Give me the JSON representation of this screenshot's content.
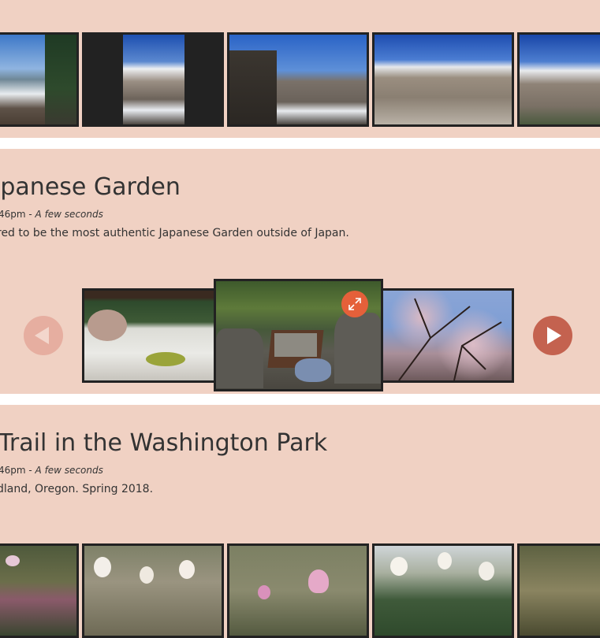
{
  "albums": [
    {
      "title": "apanese Garden",
      "meta_time": "46pm - ",
      "meta_duration": "A few seconds",
      "description": "red to be the most authentic Japanese Garden outside of Japan."
    },
    {
      "title": "Trail in the Washington Park",
      "meta_time": "46pm - ",
      "meta_duration": "A few seconds",
      "description": "dland, Oregon. Spring 2018."
    }
  ],
  "icons": {
    "prev": "chevron-left-icon",
    "next": "chevron-right-icon",
    "expand": "expand-icon"
  },
  "colors": {
    "background": "#f0d1c3",
    "accent": "#e5603a",
    "arrow_next": "#c4624f",
    "arrow_prev": "#e6aea0",
    "frame": "#222222"
  }
}
